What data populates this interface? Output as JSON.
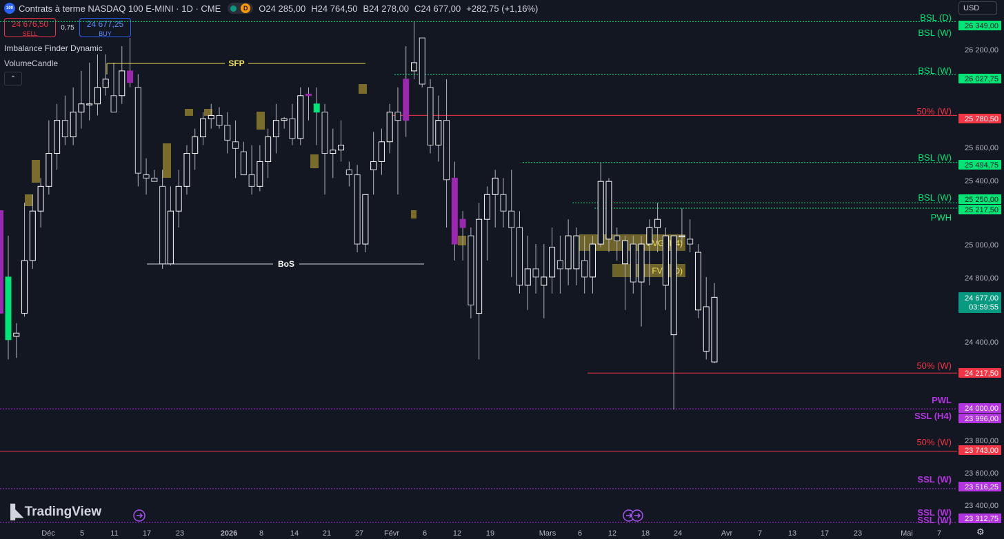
{
  "header": {
    "symbol_badge": "100",
    "title": "Contrats à terme NASDAQ 100 E-MINI · 1D · CME",
    "status_letter": "D",
    "ohlc": [
      {
        "k": "O",
        "v": "24 285,00"
      },
      {
        "k": "H",
        "v": "24 764,50"
      },
      {
        "k": "B",
        "v": "24 278,00"
      },
      {
        "k": "C",
        "v": "24 677,00"
      }
    ],
    "change": "+282,75 (+1,16%)",
    "currency": "USD"
  },
  "trade": {
    "sell_price": "24 676,50",
    "sell_label": "SELL",
    "spread": "0,75",
    "buy_price": "24 677,25",
    "buy_label": "BUY"
  },
  "indicators": [
    "Imbalance Finder Dynamic",
    "VolumeCandle"
  ],
  "collapse_glyph": "⌃",
  "colors": {
    "bg": "#131722",
    "bull": "#ffffff",
    "bear": "#9c27b0",
    "bsl": "#00e676",
    "ssl": "#b336e0",
    "fifty": "#f23645",
    "zone": "#8d7d2e",
    "last": "#089981",
    "bos": "#d1d4dc"
  },
  "price_axis": {
    "ticks": [
      "26 200,00",
      "25 600,00",
      "25 400,00",
      "25 000,00",
      "24 800,00",
      "24 400,00",
      "23 800,00",
      "23 600,00",
      "23 400,00"
    ],
    "tags": [
      {
        "text": "26 349,00",
        "kind": "bsl"
      },
      {
        "text": "26 027,75",
        "kind": "bsl"
      },
      {
        "text": "25 780,50",
        "kind": "fifty"
      },
      {
        "text": "25 494,75",
        "kind": "bsl"
      },
      {
        "text": "25 250,00",
        "kind": "bsl"
      },
      {
        "text": "25 217,50",
        "kind": "bsl"
      },
      {
        "text": "24 217,50",
        "kind": "fifty"
      },
      {
        "text": "24 000,00",
        "kind": "ssl"
      },
      {
        "text": "23 996,00",
        "kind": "ssl"
      },
      {
        "text": "23 743,00",
        "kind": "fifty"
      },
      {
        "text": "23 516,25",
        "kind": "ssl"
      },
      {
        "text": "23 312,75",
        "kind": "ssl"
      }
    ],
    "last_price": "24 677,00",
    "countdown": "03:59:55"
  },
  "level_labels": [
    {
      "text": "BSL (D)",
      "kind": "bsl"
    },
    {
      "text": "BSL (W)",
      "kind": "bsl"
    },
    {
      "text": "BSL (W)",
      "kind": "bsl"
    },
    {
      "text": "50% (W)",
      "kind": "fifty"
    },
    {
      "text": "BSL (W)",
      "kind": "bsl"
    },
    {
      "text": "BSL (W)",
      "kind": "bsl"
    },
    {
      "text": "PWH",
      "kind": "bsl"
    },
    {
      "text": "50% (W)",
      "kind": "fifty"
    },
    {
      "text": "PWL",
      "kind": "ssl"
    },
    {
      "text": "SSL (H4)",
      "kind": "ssl"
    },
    {
      "text": "50% (W)",
      "kind": "fifty"
    },
    {
      "text": "SSL (W)",
      "kind": "ssl"
    },
    {
      "text": "SSL (W)",
      "kind": "ssl"
    },
    {
      "text": "SSL (W)",
      "kind": "ssl"
    }
  ],
  "annotations": {
    "sfp": "SFP",
    "bos": "BoS",
    "fvg_h4": "FVG (H4)",
    "fvg_d": "FVG (D)"
  },
  "time_axis": [
    "Déc",
    "5",
    "11",
    "17",
    "23",
    "2026",
    "8",
    "14",
    "21",
    "27",
    "Févr",
    "6",
    "12",
    "19",
    "Mars",
    "6",
    "12",
    "18",
    "24",
    "Avr",
    "7",
    "13",
    "17",
    "23",
    "Mai",
    "7"
  ],
  "branding": {
    "name": "TradingView"
  },
  "chart_data": {
    "type": "candlestick",
    "candles": [
      {
        "o": 24800,
        "h": 25050,
        "l": 24300,
        "c": 24420
      },
      {
        "o": 24440,
        "h": 24520,
        "l": 24310,
        "c": 24460
      },
      {
        "o": 24580,
        "h": 25250,
        "l": 24560,
        "c": 24900
      },
      {
        "o": 24900,
        "h": 25300,
        "l": 24850,
        "c": 25200
      },
      {
        "o": 25200,
        "h": 25400,
        "l": 25100,
        "c": 25350
      },
      {
        "o": 25350,
        "h": 25750,
        "l": 25300,
        "c": 25550
      },
      {
        "o": 25550,
        "h": 25850,
        "l": 25450,
        "c": 25750
      },
      {
        "o": 25750,
        "h": 25900,
        "l": 25600,
        "c": 25650
      },
      {
        "o": 25650,
        "h": 25950,
        "l": 25600,
        "c": 25800
      },
      {
        "o": 25800,
        "h": 26050,
        "l": 25700,
        "c": 25850
      },
      {
        "o": 25850,
        "h": 26100,
        "l": 25750,
        "c": 25850
      },
      {
        "o": 25850,
        "h": 26150,
        "l": 25780,
        "c": 25950
      },
      {
        "o": 25950,
        "h": 26150,
        "l": 25900,
        "c": 26000
      },
      {
        "o": 25900,
        "h": 26100,
        "l": 25800,
        "c": 25800
      },
      {
        "o": 25900,
        "h": 26200,
        "l": 25850,
        "c": 26050
      },
      {
        "o": 26050,
        "h": 26250,
        "l": 25950,
        "c": 25980
      },
      {
        "o": 25950,
        "h": 26030,
        "l": 25350,
        "c": 25430
      },
      {
        "o": 25420,
        "h": 25520,
        "l": 25300,
        "c": 25400
      },
      {
        "o": 25400,
        "h": 25450,
        "l": 25380,
        "c": 25380
      },
      {
        "o": 25350,
        "h": 25450,
        "l": 24850,
        "c": 24880
      },
      {
        "o": 24880,
        "h": 25350,
        "l": 24870,
        "c": 25200
      },
      {
        "o": 25200,
        "h": 25450,
        "l": 25100,
        "c": 25350
      },
      {
        "o": 25350,
        "h": 25600,
        "l": 25300,
        "c": 25550
      },
      {
        "o": 25550,
        "h": 25700,
        "l": 25450,
        "c": 25650
      },
      {
        "o": 25650,
        "h": 25800,
        "l": 25600,
        "c": 25760
      },
      {
        "o": 25760,
        "h": 25850,
        "l": 25700,
        "c": 25780
      },
      {
        "o": 25780,
        "h": 25830,
        "l": 25700,
        "c": 25720
      },
      {
        "o": 25720,
        "h": 25800,
        "l": 25550,
        "c": 25630
      },
      {
        "o": 25620,
        "h": 25750,
        "l": 25400,
        "c": 25580
      },
      {
        "o": 25560,
        "h": 25620,
        "l": 25450,
        "c": 25420
      },
      {
        "o": 25420,
        "h": 25600,
        "l": 25300,
        "c": 25350
      },
      {
        "o": 25350,
        "h": 25600,
        "l": 25320,
        "c": 25500
      },
      {
        "o": 25500,
        "h": 25700,
        "l": 25400,
        "c": 25650
      },
      {
        "o": 25650,
        "h": 25850,
        "l": 25550,
        "c": 25750
      },
      {
        "o": 25750,
        "h": 25770,
        "l": 25700,
        "c": 25760
      },
      {
        "o": 25760,
        "h": 25850,
        "l": 25600,
        "c": 25640
      },
      {
        "o": 25640,
        "h": 25950,
        "l": 25600,
        "c": 25900
      },
      {
        "o": 25900,
        "h": 25950,
        "l": 25750,
        "c": 25910
      },
      {
        "o": 25850,
        "h": 25950,
        "l": 25600,
        "c": 25800
      },
      {
        "o": 25800,
        "h": 25850,
        "l": 25300,
        "c": 25550
      },
      {
        "o": 25550,
        "h": 25700,
        "l": 25400,
        "c": 25570
      },
      {
        "o": 25570,
        "h": 25750,
        "l": 25500,
        "c": 25600
      },
      {
        "o": 25450,
        "h": 25500,
        "l": 25350,
        "c": 25420
      },
      {
        "o": 25420,
        "h": 25480,
        "l": 24950,
        "c": 25000
      },
      {
        "o": 25000,
        "h": 25300,
        "l": 24950,
        "c": 25300
      },
      {
        "o": 25450,
        "h": 25680,
        "l": 25300,
        "c": 25500
      },
      {
        "o": 25500,
        "h": 25700,
        "l": 25420,
        "c": 25620
      },
      {
        "o": 25620,
        "h": 25850,
        "l": 25550,
        "c": 25800
      },
      {
        "o": 25800,
        "h": 25950,
        "l": 25300,
        "c": 25750
      },
      {
        "o": 25750,
        "h": 26200,
        "l": 25650,
        "c": 26000
      },
      {
        "o": 26050,
        "h": 26349,
        "l": 26000,
        "c": 26100
      },
      {
        "o": 26250,
        "h": 26250,
        "l": 25950,
        "c": 25970
      },
      {
        "o": 25950,
        "h": 26000,
        "l": 25550,
        "c": 25600
      },
      {
        "o": 25600,
        "h": 25900,
        "l": 25500,
        "c": 25750
      },
      {
        "o": 25750,
        "h": 26000,
        "l": 25100,
        "c": 25390
      },
      {
        "o": 25400,
        "h": 25500,
        "l": 24900,
        "c": 25000
      },
      {
        "o": 25150,
        "h": 25200,
        "l": 24900,
        "c": 25100
      },
      {
        "o": 25050,
        "h": 25100,
        "l": 24550,
        "c": 24630
      },
      {
        "o": 24580,
        "h": 25250,
        "l": 24300,
        "c": 25150
      },
      {
        "o": 25150,
        "h": 25350,
        "l": 24900,
        "c": 25300
      },
      {
        "o": 25300,
        "h": 25450,
        "l": 25100,
        "c": 25400
      },
      {
        "o": 25300,
        "h": 25400,
        "l": 25100,
        "c": 25200
      },
      {
        "o": 25200,
        "h": 25450,
        "l": 24800,
        "c": 25100
      },
      {
        "o": 25100,
        "h": 25200,
        "l": 24700,
        "c": 24750
      },
      {
        "o": 24750,
        "h": 25050,
        "l": 24600,
        "c": 24850
      },
      {
        "o": 24850,
        "h": 25000,
        "l": 24700,
        "c": 24800
      },
      {
        "o": 24750,
        "h": 25000,
        "l": 24550,
        "c": 24800
      },
      {
        "o": 24800,
        "h": 25100,
        "l": 24700,
        "c": 24980
      },
      {
        "o": 24900,
        "h": 25050,
        "l": 24700,
        "c": 24850
      },
      {
        "o": 24850,
        "h": 25150,
        "l": 24750,
        "c": 25050
      },
      {
        "o": 24850,
        "h": 25100,
        "l": 24750,
        "c": 25050
      },
      {
        "o": 24900,
        "h": 25050,
        "l": 24700,
        "c": 24800
      },
      {
        "o": 24800,
        "h": 25050,
        "l": 24700,
        "c": 25000
      },
      {
        "o": 25000,
        "h": 25490,
        "l": 24980,
        "c": 25380
      },
      {
        "o": 25030,
        "h": 25400,
        "l": 24950,
        "c": 25380
      },
      {
        "o": 25050,
        "h": 25100,
        "l": 24900,
        "c": 25020
      },
      {
        "o": 24880,
        "h": 25050,
        "l": 24600,
        "c": 25020
      },
      {
        "o": 25000,
        "h": 25050,
        "l": 24700,
        "c": 24770
      },
      {
        "o": 24770,
        "h": 25050,
        "l": 24500,
        "c": 25000
      },
      {
        "o": 25000,
        "h": 25150,
        "l": 24750,
        "c": 25100
      },
      {
        "o": 25100,
        "h": 25250,
        "l": 24950,
        "c": 25150
      },
      {
        "o": 24750,
        "h": 25100,
        "l": 24600,
        "c": 25050
      },
      {
        "o": 24450,
        "h": 25050,
        "l": 23996,
        "c": 25050
      },
      {
        "o": 25050,
        "h": 25217,
        "l": 25000,
        "c": 25050
      },
      {
        "o": 25030,
        "h": 25150,
        "l": 24950,
        "c": 25000
      },
      {
        "o": 24600,
        "h": 25000,
        "l": 24550,
        "c": 24950
      },
      {
        "o": 24350,
        "h": 24800,
        "l": 24300,
        "c": 24620
      },
      {
        "o": 24285,
        "h": 24764,
        "l": 24278,
        "c": 24677
      }
    ]
  }
}
